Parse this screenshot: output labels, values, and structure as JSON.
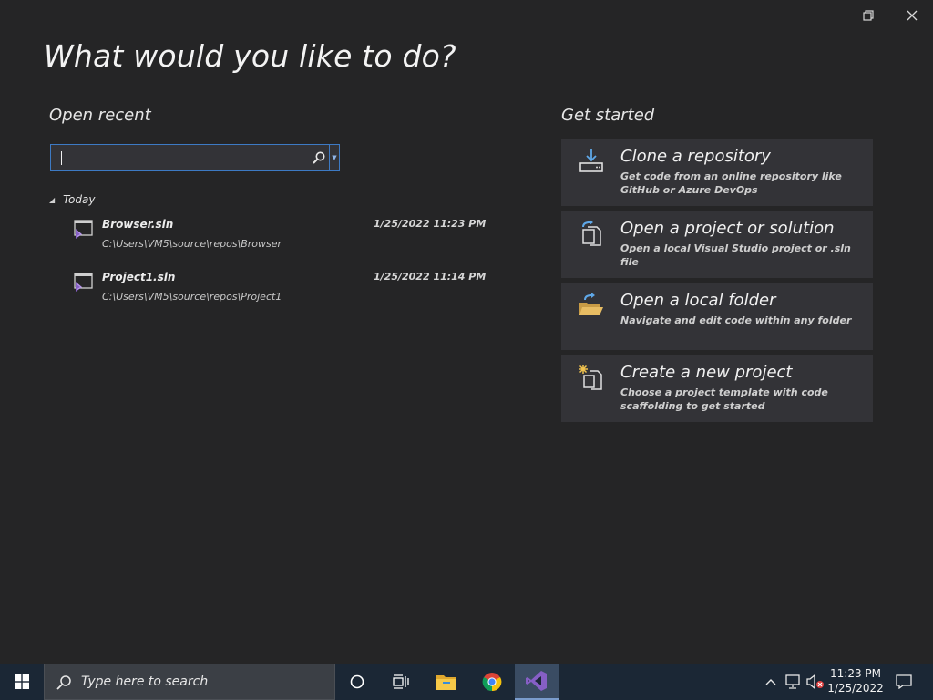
{
  "window": {
    "restore_icon": "restore-icon",
    "close_icon": "close-icon"
  },
  "title": "What would you like to do?",
  "open_recent": {
    "heading": "Open recent",
    "search": {
      "value": "",
      "placeholder": ""
    },
    "group": "Today",
    "items": [
      {
        "name": "Browser.sln",
        "path": "C:\\Users\\VM5\\source\\repos\\Browser",
        "date": "1/25/2022 11:23 PM"
      },
      {
        "name": "Project1.sln",
        "path": "C:\\Users\\VM5\\source\\repos\\Project1",
        "date": "1/25/2022 11:14 PM"
      }
    ]
  },
  "get_started": {
    "heading": "Get started",
    "cards": [
      {
        "title": "Clone a repository",
        "desc": "Get code from an online repository like GitHub or Azure DevOps",
        "icon": "clone-icon"
      },
      {
        "title": "Open a project or solution",
        "desc": "Open a local Visual Studio project or .sln file",
        "icon": "open-project-icon"
      },
      {
        "title": "Open a local folder",
        "desc": "Navigate and edit code within any folder",
        "icon": "folder-icon"
      },
      {
        "title": "Create a new project",
        "desc": "Choose a project template with code scaffolding to get started",
        "icon": "new-project-icon"
      }
    ]
  },
  "taskbar": {
    "search_placeholder": "Type here to search",
    "time": "11:23 PM",
    "date": "1/25/2022"
  },
  "colors": {
    "background": "#252526",
    "card": "#333337",
    "accent": "#3d7ac4",
    "vs_purple": "#865fc5",
    "taskbar": "#1b2735"
  }
}
